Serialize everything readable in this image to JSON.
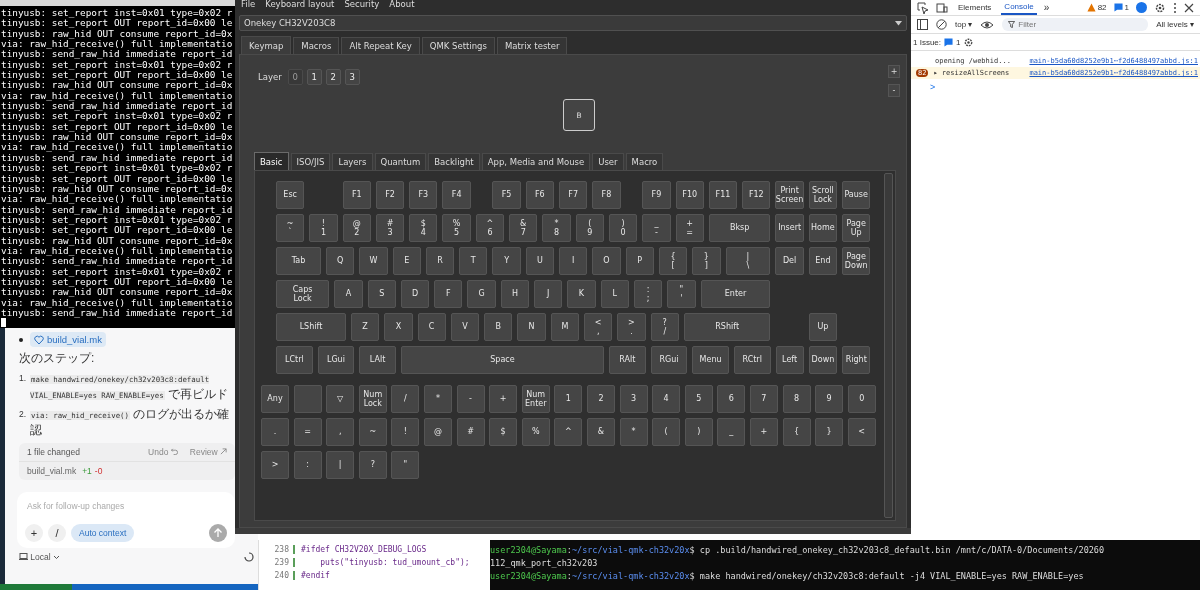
{
  "terminal_log": {
    "lines": [
      "tinyusb: set_report inst=0x01 type=0x02 r",
      "tinyusb: set_report OUT report_id=0x00 le",
      "tinyusb: raw_hid OUT consume report_id=0x",
      "via: raw_hid_receive() full implementatio",
      "tinyusb: send_raw_hid immediate report_id",
      "tinyusb: set_report inst=0x01 type=0x02 r",
      "tinyusb: set_report OUT report_id=0x00 le",
      "tinyusb: raw_hid OUT consume report_id=0x",
      "via: raw_hid_receive() full implementatio",
      "tinyusb: send_raw_hid immediate report_id",
      "tinyusb: set_report inst=0x01 type=0x02 r",
      "tinyusb: set_report OUT report_id=0x00 le",
      "tinyusb: raw_hid OUT consume report_id=0x",
      "via: raw_hid_receive() full implementatio",
      "tinyusb: send_raw_hid immediate report_id",
      "tinyusb: set_report inst=0x01 type=0x02 r",
      "tinyusb: set_report OUT report_id=0x00 le",
      "tinyusb: raw_hid OUT consume report_id=0x",
      "via: raw_hid_receive() full implementatio",
      "tinyusb: send_raw_hid immediate report_id",
      "tinyusb: set_report inst=0x01 type=0x02 r",
      "tinyusb: set_report OUT report_id=0x00 le",
      "tinyusb: raw_hid OUT consume report_id=0x",
      "via: raw_hid_receive() full implementatio",
      "tinyusb: send_raw_hid immediate report_id",
      "tinyusb: set_report inst=0x01 type=0x02 r",
      "tinyusb: set_report OUT report_id=0x00 le",
      "tinyusb: raw_hid OUT consume report_id=0x",
      "via: raw_hid_receive() full implementatio",
      "tinyusb: send_raw_hid immediate report_id"
    ]
  },
  "chat": {
    "file_chip": "build_vial.mk",
    "heading": "次のステップ:",
    "steps": [
      {
        "number": "1.",
        "code": "make handwired/onekey/ch32v203c8:default VIAL_ENABLE=yes RAW_ENABLE=yes",
        "text": " で再ビルド"
      },
      {
        "number": "2.",
        "code": "via: raw_hid_receive()",
        "text": " のログが出るか確認"
      }
    ],
    "changes": {
      "title": "1 file changed",
      "undo": "Undo",
      "review": "Review",
      "file": "build_vial.mk",
      "added": "+1",
      "removed": "-0"
    },
    "input": {
      "placeholder": "Ask for follow-up changes"
    },
    "buttons": [
      "+",
      "/"
    ],
    "context_button": "Auto context",
    "mode": "Local"
  },
  "vial": {
    "menu": [
      "File",
      "Keyboard layout",
      "Security",
      "About"
    ],
    "device": "Onekey CH32V203C8",
    "tabs": [
      {
        "label": "Keymap",
        "selected": true
      },
      {
        "label": "Macros",
        "selected": false
      },
      {
        "label": "Alt Repeat Key",
        "selected": false
      },
      {
        "label": "QMK Settings",
        "selected": false
      },
      {
        "label": "Matrix tester",
        "selected": false
      }
    ],
    "layer_label": "Layer",
    "layers": [
      {
        "label": "0",
        "selected": true
      },
      {
        "label": "1",
        "selected": false
      },
      {
        "label": "2",
        "selected": false
      },
      {
        "label": "3",
        "selected": false
      }
    ],
    "zoom_buttons": [
      "+",
      "-"
    ],
    "layout_key": "B",
    "key_tabs": [
      {
        "label": "Basic",
        "selected": true
      },
      {
        "label": "ISO/JIS",
        "selected": false
      },
      {
        "label": "Layers",
        "selected": false
      },
      {
        "label": "Quantum",
        "selected": false
      },
      {
        "label": "Backlight",
        "selected": false
      },
      {
        "label": "App, Media and Mouse",
        "selected": false
      },
      {
        "label": "User",
        "selected": false
      },
      {
        "label": "Macro",
        "selected": false
      }
    ],
    "keyboard_rows": [
      [
        "Esc",
        "F1",
        "F2",
        "F3",
        "F4",
        "F5",
        "F6",
        "F7",
        "F8",
        "F9",
        "F10",
        "F11",
        "F12",
        "Print\nScreen",
        "Scroll\nLock",
        "Pause"
      ],
      [
        "~\n`",
        "!\n1",
        "@\n2",
        "#\n3",
        "$\n4",
        "%\n5",
        "^\n6",
        "&\n7",
        "*\n8",
        "(\n9",
        ")\n0",
        "_\n-",
        "+\n=",
        "Bksp",
        "Insert",
        "Home",
        "Page\nUp"
      ],
      [
        "Tab",
        "Q",
        "W",
        "E",
        "R",
        "T",
        "Y",
        "U",
        "I",
        "O",
        "P",
        "{\n[",
        "}\n]",
        "|\n\\",
        "Del",
        "End",
        "Page\nDown"
      ],
      [
        "Caps\nLock",
        "A",
        "S",
        "D",
        "F",
        "G",
        "H",
        "J",
        "K",
        "L",
        ":\n;",
        "\"\n'",
        "Enter"
      ],
      [
        "LShift",
        "Z",
        "X",
        "C",
        "V",
        "B",
        "N",
        "M",
        "<\n,",
        ">\n.",
        "?\n/",
        "RShift",
        "Up"
      ],
      [
        "LCtrl",
        "LGui",
        "LAlt",
        "Space",
        "RAlt",
        "RGui",
        "Menu",
        "RCtrl",
        "Left",
        "Down",
        "Right"
      ]
    ],
    "extra_rows": [
      [
        "Any",
        null,
        "▽",
        "Num\nLock",
        "/",
        "*",
        "-",
        "+",
        "Num\nEnter",
        "1",
        "2",
        "3",
        "4",
        "5",
        "6",
        "7",
        "8",
        "9",
        "0"
      ],
      [
        ".",
        "=",
        ",",
        "~",
        "!",
        "@",
        "#",
        "$",
        "%",
        "^",
        "&",
        "*",
        "(",
        ")",
        "_",
        "+",
        "{",
        "}",
        "<"
      ],
      [
        ">",
        ":",
        "|",
        "?",
        "\""
      ]
    ]
  },
  "devtools": {
    "tabs": [
      {
        "label": "Elements",
        "selected": false
      },
      {
        "label": "Console",
        "selected": true
      }
    ],
    "more": "»",
    "warnings": "82",
    "messages": "1",
    "context": "top ▾",
    "filter": {
      "placeholder": "Filter"
    },
    "levels": "All levels ▾",
    "issues": "1 Issue:",
    "issue_count": "1",
    "console": [
      {
        "kind": "log",
        "text": "opening /webhid...",
        "source": "main-b5da60d8252e9b1⋯f2d6488497abbd.js:1"
      },
      {
        "kind": "warning",
        "count": "82",
        "text": "▸ resizeAllScreens",
        "source": "main-b5da60d8252e9b1⋯f2d6488497abbd.js:1"
      }
    ],
    "prompt": ">"
  },
  "editor": {
    "lines": [
      {
        "number": "238",
        "code": "#ifdef CH32V20X_DEBUG_LOGS"
      },
      {
        "number": "239",
        "code": "    puts(\"tinyusb: tud_umount_cb\");"
      },
      {
        "number": "240",
        "code": "#endif"
      }
    ]
  },
  "shell": {
    "lines": [
      {
        "kind": "prompt",
        "user": "user2304@Sayama",
        "separator": ":",
        "path": "~/src/vial-qmk-ch32v20x",
        "command": "$ cp .build/handwired_onekey_ch32v203c8_default.bin /mnt/c/DATA-0/Documents/20260"
      },
      {
        "kind": "output",
        "text": "112_qmk_port_ch32v203"
      },
      {
        "kind": "prompt",
        "user": "user2304@Sayama",
        "separator": ":",
        "path": "~/src/vial-qmk-ch32v20x",
        "command": "$ make handwired/onekey/ch32v203c8:default -j4 VIAL_ENABLE=yes RAW_ENABLE=yes"
      }
    ]
  }
}
